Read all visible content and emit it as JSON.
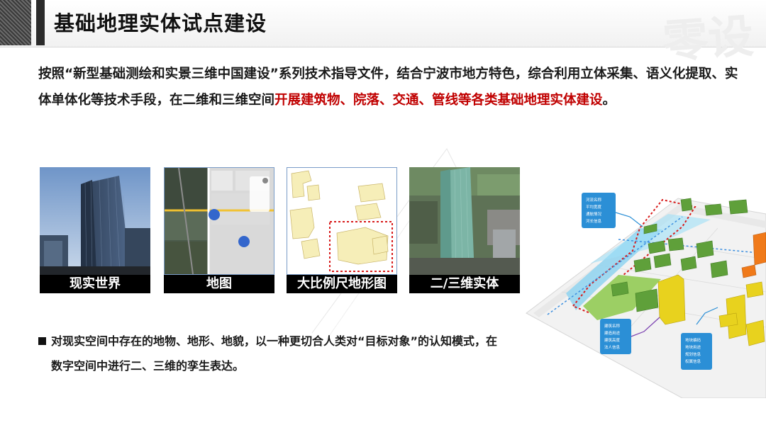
{
  "header": {
    "title": "基础地理实体试点建设",
    "watermark": "零设"
  },
  "intro": {
    "part1": "按照“新型基础测绘和实景三维中国建设”系列技术指导文件，结合宁波市地方特色，综合利用立体采集、语义化提取、实体单体化等技术手段，在二维和三维空间",
    "highlight": "开展建筑物、院落、交通、管线等各类基础地理实体建设",
    "part2": "。"
  },
  "panels": [
    {
      "caption": "现实世界",
      "icon": "building-photo"
    },
    {
      "caption": "地图",
      "icon": "map-app-screenshot"
    },
    {
      "caption": "大比例尺地形图",
      "icon": "topographic-map"
    },
    {
      "caption": "二/三维实体",
      "icon": "3d-city-model"
    }
  ],
  "bullet": {
    "text": "对现实空间中存在的地物、地形、地貌，以一种更切合人类对“目标对象”的认知模式，在数字空间中进行二、三维的孪生表达。"
  },
  "model_labels": {
    "top": [
      "河流名称",
      "平均宽度",
      "通航情况",
      "河长信息"
    ],
    "bottom_left": [
      "建筑名称",
      "建造用途",
      "建筑高度",
      "法人信息"
    ],
    "bottom_right": [
      "地块编码",
      "地块用途",
      "规划信息",
      "权属信息"
    ]
  },
  "colors": {
    "highlight": "#c00000",
    "label_box": "#2b8fd6",
    "building_green": "#5fa03a",
    "building_yellow": "#e8d21e",
    "building_orange": "#f07a1a",
    "water": "#8fd3f0"
  }
}
